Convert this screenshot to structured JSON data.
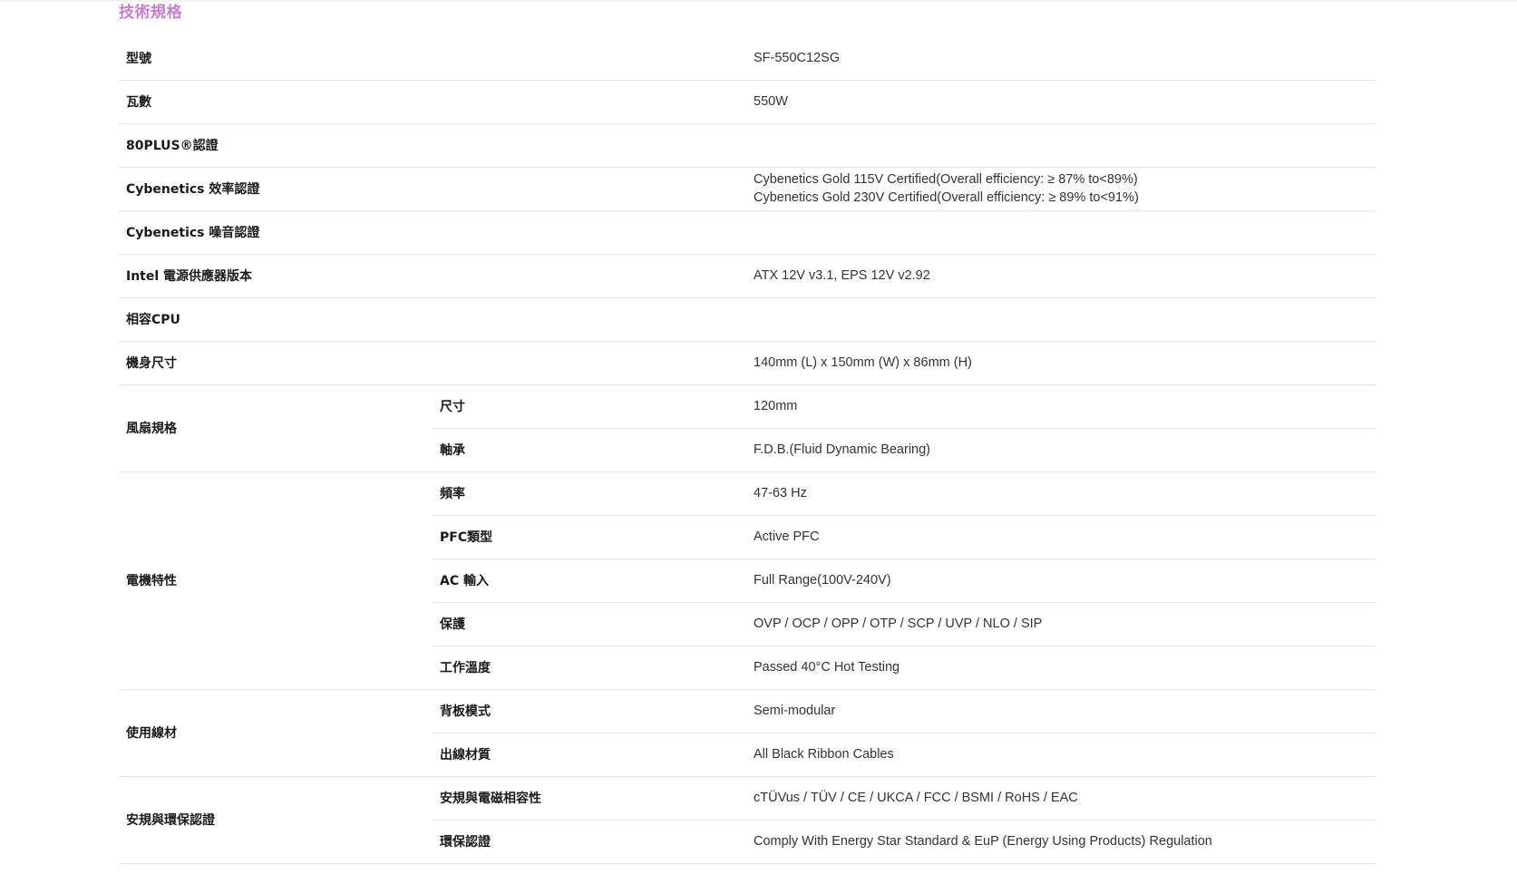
{
  "section": {
    "title": "技術規格"
  },
  "rows": {
    "model": {
      "label": "型號",
      "value": "SF-550C12SG"
    },
    "wattage": {
      "label": "瓦數",
      "value": "550W"
    },
    "plus80": {
      "label": "80PLUS®認證",
      "value": ""
    },
    "cyb_eff": {
      "label": "Cybenetics 效率認證",
      "value1": "Cybenetics Gold 115V Certified(Overall efficiency: ≥ 87% to<89%)",
      "value2": "Cybenetics Gold 230V Certified(Overall efficiency: ≥ 89% to<91%)"
    },
    "cyb_noise": {
      "label": "Cybenetics 噪音認證",
      "value": ""
    },
    "intel": {
      "label": "Intel 電源供應器版本",
      "value": "ATX 12V v3.1, EPS 12V v2.92"
    },
    "cpu": {
      "label": "相容CPU",
      "value": ""
    },
    "dimensions": {
      "label": "機身尺寸",
      "value": "140mm (L) x 150mm (W) x 86mm (H)"
    },
    "fan": {
      "label": "風扇規格",
      "size": {
        "label": "尺寸",
        "value": "120mm"
      },
      "bearing": {
        "label": "軸承",
        "value": "F.D.B.(Fluid Dynamic Bearing)"
      }
    },
    "electrical": {
      "label": "電機特性",
      "frequency": {
        "label": "頻率",
        "value": "47-63 Hz"
      },
      "pfc": {
        "label": "PFC類型",
        "value": "Active PFC"
      },
      "ac": {
        "label": "AC 輸入",
        "value": "Full Range(100V-240V)"
      },
      "protection": {
        "label": "保護",
        "value": "OVP / OCP / OPP / OTP / SCP / UVP / NLO / SIP"
      },
      "temp": {
        "label": "工作溫度",
        "value": "Passed 40°C Hot Testing"
      }
    },
    "cables": {
      "label": "使用線材",
      "backplate": {
        "label": "背板模式",
        "value": "Semi-modular"
      },
      "material": {
        "label": "出線材質",
        "value": "All Black Ribbon Cables"
      }
    },
    "cert": {
      "label": "安規與環保認證",
      "safety": {
        "label": "安規與電磁相容性",
        "value": "cTÜVus / TÜV / CE / UKCA / FCC / BSMI / RoHS / EAC"
      },
      "eco": {
        "label": "環保認證",
        "value": "Comply With Energy Star Standard & EuP (Energy Using Products) Regulation"
      }
    }
  }
}
